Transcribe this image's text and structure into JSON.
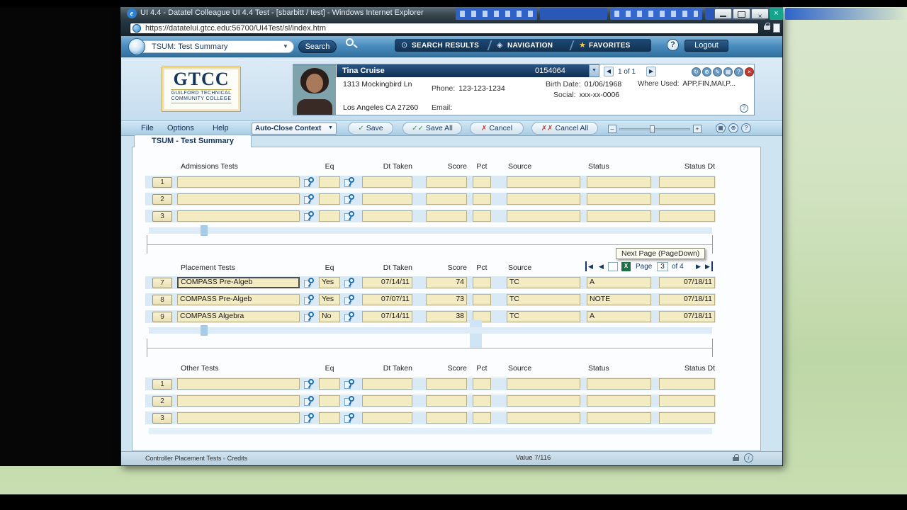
{
  "browser": {
    "title": "UI 4.4 - Datatel Colleague UI 4.4 Test - [sbarbitt / test] - Windows Internet Explorer",
    "url": "https://datatelui.gtcc.edu:56700/UI4Test/sl/index.htm"
  },
  "app_toolbar": {
    "context_value": "TSUM: Test Summary",
    "search_label": "Search",
    "search_results_label": "SEARCH RESULTS",
    "navigation_label": "NAVIGATION",
    "favorites_label": "FAVORITES",
    "help_label": "?",
    "logout_label": "Logout"
  },
  "logo": {
    "acronym": "GTCC",
    "line1": "GUILFORD TECHNICAL",
    "line2": "COMMUNITY COLLEGE"
  },
  "person_card": {
    "name": "Tina Cruise",
    "id": "0154064",
    "address1": "1313 Mockingbird Ln",
    "address2": "Los Angeles CA 27260",
    "phone_label": "Phone:",
    "phone": "123-123-1234",
    "email_label": "Email:",
    "email": "",
    "birth_label": "Birth Date:",
    "birth_date": "01/06/1968",
    "social_label": "Social:",
    "social": "xxx-xx-0006",
    "where_used_label": "Where Used:",
    "where_used": "APP,FIN,MAI,P...",
    "pager_text": "1 of 1"
  },
  "menu_bar": {
    "file": "File",
    "options": "Options",
    "help": "Help",
    "context_mode": "Auto-Close Context",
    "save": "Save",
    "save_all": "Save All",
    "cancel": "Cancel",
    "cancel_all": "Cancel All"
  },
  "tab_label": "TSUM - Test Summary",
  "form": {
    "columns": {
      "eq": "Eq",
      "dt_taken": "Dt Taken",
      "score": "Score",
      "pct": "Pct",
      "source": "Source",
      "status": "Status",
      "status_dt": "Status Dt"
    },
    "sections": [
      {
        "title": "Admissions Tests",
        "rows": [
          {
            "num": "1",
            "name": "",
            "eq": "",
            "dt": "",
            "score": "",
            "pct": "",
            "source": "",
            "status": "",
            "status_dt": ""
          },
          {
            "num": "2",
            "name": "",
            "eq": "",
            "dt": "",
            "score": "",
            "pct": "",
            "source": "",
            "status": "",
            "status_dt": ""
          },
          {
            "num": "3",
            "name": "",
            "eq": "",
            "dt": "",
            "score": "",
            "pct": "",
            "source": "",
            "status": "",
            "status_dt": ""
          }
        ]
      },
      {
        "title": "Placement Tests",
        "rows": [
          {
            "num": "7",
            "name": "COMPASS Pre-Algeb",
            "eq": "Yes",
            "dt": "07/14/11",
            "score": "74",
            "pct": "",
            "source": "TC",
            "status": "A",
            "status_dt": "07/18/11"
          },
          {
            "num": "8",
            "name": "COMPASS Pre-Algeb",
            "eq": "Yes",
            "dt": "07/07/11",
            "score": "73",
            "pct": "",
            "source": "TC",
            "status": "NOTE",
            "status_dt": "07/18/11"
          },
          {
            "num": "9",
            "name": "COMPASS Algebra",
            "eq": "No",
            "dt": "07/14/11",
            "score": "38",
            "pct": "",
            "source": "TC",
            "status": "A",
            "status_dt": "07/18/11"
          }
        ]
      },
      {
        "title": "Other Tests",
        "rows": [
          {
            "num": "1",
            "name": "",
            "eq": "",
            "dt": "",
            "score": "",
            "pct": "",
            "source": "",
            "status": "",
            "status_dt": ""
          },
          {
            "num": "2",
            "name": "",
            "eq": "",
            "dt": "",
            "score": "",
            "pct": "",
            "source": "",
            "status": "",
            "status_dt": ""
          },
          {
            "num": "3",
            "name": "",
            "eq": "",
            "dt": "",
            "score": "",
            "pct": "",
            "source": "",
            "status": "",
            "status_dt": ""
          }
        ]
      }
    ]
  },
  "pagination": {
    "page_label": "Page",
    "current": "3",
    "of": "of 4",
    "tooltip": "Next Page (PageDown)"
  },
  "status_bar": {
    "left": "Controller Placement Tests ◦ Credits",
    "value": "Value 7/116"
  },
  "icons": {
    "ie": "e",
    "close": "×",
    "dropdown": "▼",
    "left": "◀",
    "right": "▶",
    "check": "✓",
    "double_check": "✓✓",
    "cross": "✗",
    "double_cross": "✗✗",
    "star": "★",
    "search_results": "⊙",
    "navigation": "◈",
    "refresh": "↻",
    "globe": "⊕",
    "pencil": "✎",
    "grid": "▦",
    "question": "?",
    "info": "i",
    "minus": "–",
    "plus": "+",
    "excel": "X"
  },
  "colors": {
    "field_bg": "#f3ebc1",
    "navy": "#14365f",
    "toolbar_blue": "#4a8cbe",
    "desktop_green": "#cfe2bd",
    "excel_green": "#1e7145",
    "stripe_blue": "#d9e9f6"
  }
}
